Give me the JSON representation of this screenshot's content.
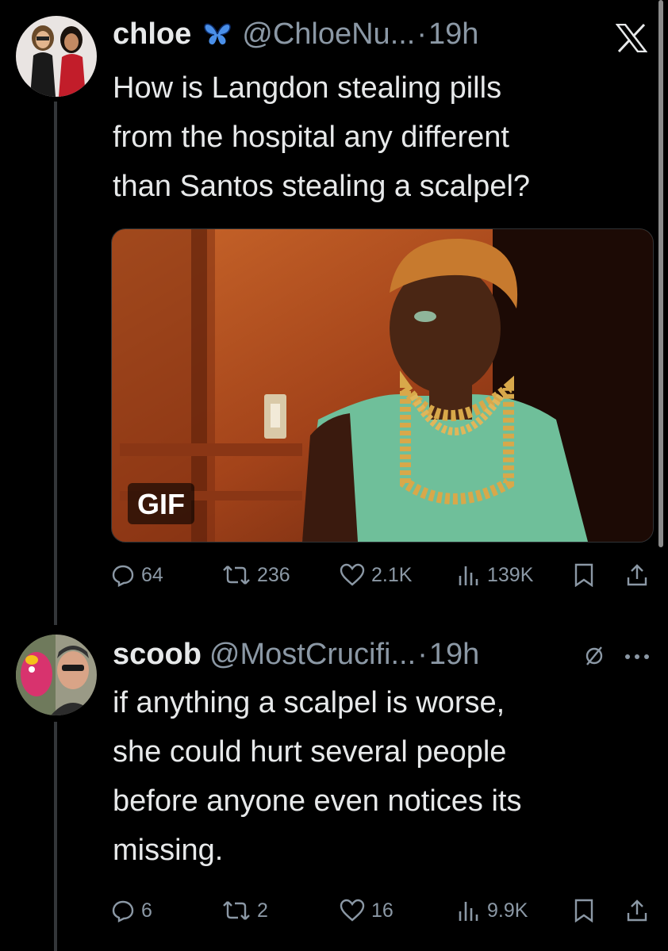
{
  "tweets": [
    {
      "name": "chloe",
      "handle": "@ChloeNu...",
      "separator": "·",
      "time": "19h",
      "text": "How is Langdon stealing pills\nfrom the hospital any different\nthan Santos stealing a scalpel?",
      "media_badge": "GIF",
      "stats": {
        "replies": "64",
        "retweets": "236",
        "likes": "2.1K",
        "views": "139K"
      }
    },
    {
      "name": "scoob",
      "handle": "@MostCrucifi...",
      "separator": "·",
      "time": "19h",
      "text": "if anything a scalpel is worse,\nshe could hurt several people\nbefore anyone even notices its\nmissing.",
      "stats": {
        "replies": "6",
        "retweets": "2",
        "likes": "16",
        "views": "9.9K"
      }
    }
  ],
  "icons": {
    "brand": "x-logo-icon",
    "badge": "butterfly-icon",
    "muted": "slash-circle-icon",
    "more": "more-dots-icon"
  },
  "colors": {
    "background": "#000000",
    "text": "#e7e9ea",
    "secondary": "#8b98a5",
    "butterfly": "#4a8fe8"
  }
}
